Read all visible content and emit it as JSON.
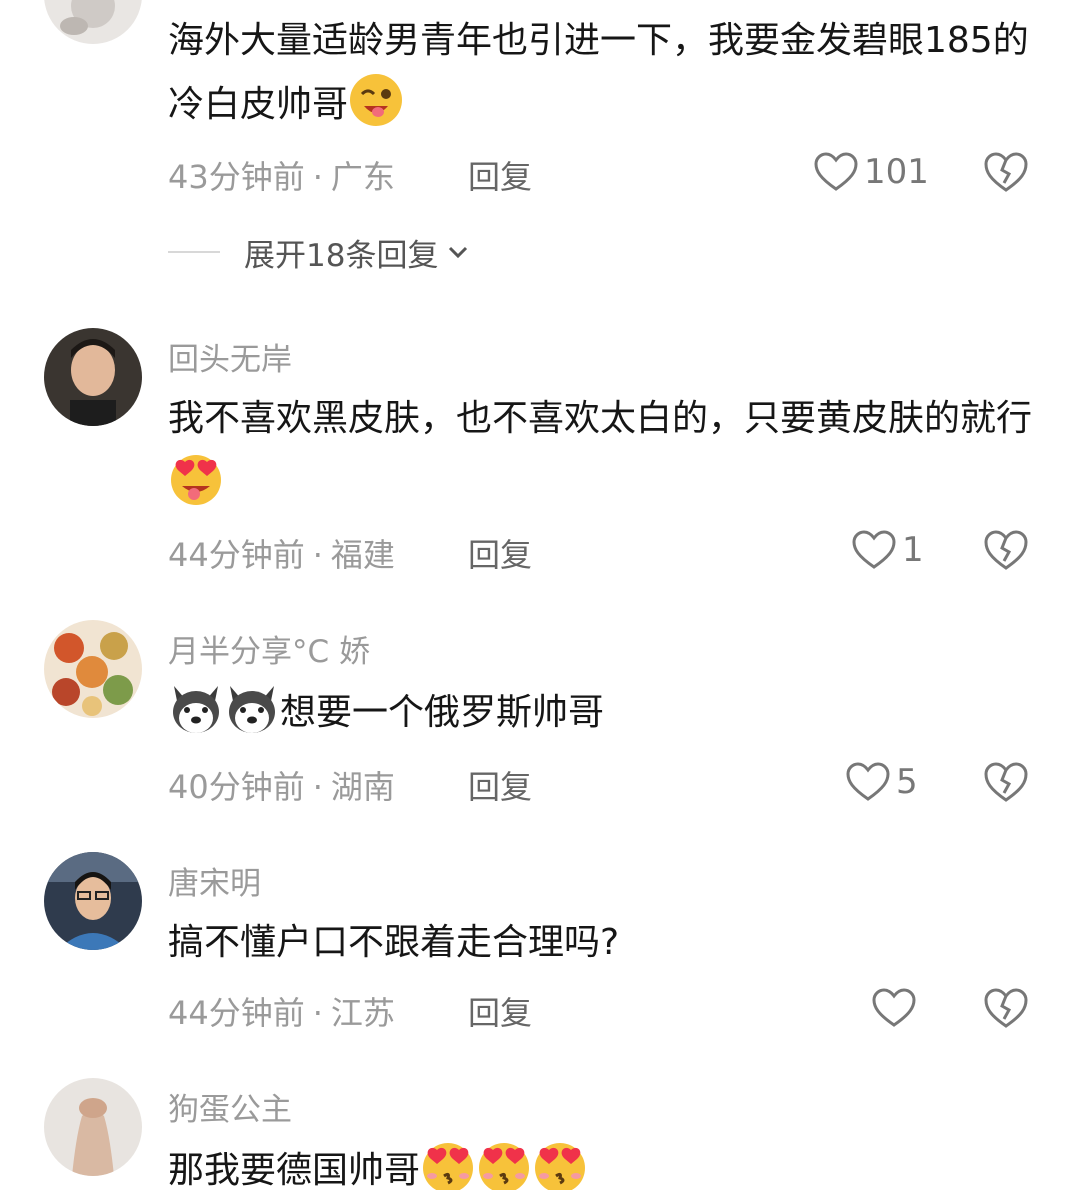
{
  "comments": [
    {
      "username": "",
      "text": "海外大量适龄男青年也引进一下，我要金发碧眼185的冷白皮帅哥",
      "emoji": [
        "wink-tongue-emoji"
      ],
      "time": "43分钟前",
      "location": "广东",
      "reply_label": "回复",
      "likes": "101",
      "expand_replies": "展开18条回复"
    },
    {
      "username": "回头无岸",
      "text": "我不喜欢黑皮肤，也不喜欢太白的，只要黄皮肤的就行",
      "emoji": [
        "heart-eyes-tongue-emoji"
      ],
      "time": "44分钟前",
      "location": "福建",
      "reply_label": "回复",
      "likes": "1"
    },
    {
      "username": "月半分享°C 娇",
      "text": "想要一个俄罗斯帅哥",
      "emoji": [
        "husky-emoji",
        "husky-emoji"
      ],
      "time": "40分钟前",
      "location": "湖南",
      "reply_label": "回复",
      "likes": "5"
    },
    {
      "username": "唐宋明",
      "text": "搞不懂户口不跟着走合理吗?",
      "emoji": [],
      "time": "44分钟前",
      "location": "江苏",
      "reply_label": "回复",
      "likes": ""
    },
    {
      "username": "狗蛋公主",
      "text": "那我要德国帅哥",
      "emoji": [
        "heart-eyes-kiss-emoji",
        "heart-eyes-kiss-emoji",
        "heart-eyes-kiss-emoji"
      ],
      "time": "",
      "location": "",
      "reply_label": "",
      "likes": ""
    }
  ],
  "colors": {
    "meta_gray": "#9a9a9a",
    "body_text": "#161616",
    "emoji_yellow": "#f7c23a",
    "heart_red": "#f0324a"
  },
  "icons": {
    "like": "heart-outline-icon",
    "dislike": "broken-heart-icon",
    "expand": "chevron-down-icon"
  }
}
